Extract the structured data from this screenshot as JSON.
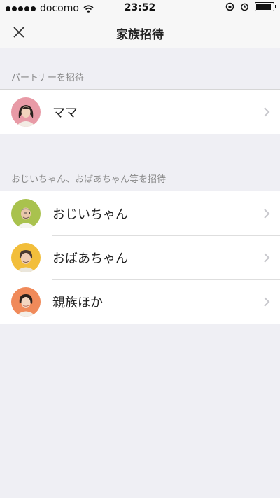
{
  "status": {
    "carrier": "docomo",
    "time": "23:52"
  },
  "nav": {
    "title": "家族招待"
  },
  "sections": [
    {
      "header": "パートナーを招待",
      "items": [
        {
          "label": "ママ",
          "avatar_bg": "#e89aa6"
        }
      ]
    },
    {
      "header": "おじいちゃん、おばあちゃん等を招待",
      "items": [
        {
          "label": "おじいちゃん",
          "avatar_bg": "#a9c24e"
        },
        {
          "label": "おばあちゃん",
          "avatar_bg": "#f2be3b"
        },
        {
          "label": "親族ほか",
          "avatar_bg": "#f08a5a"
        }
      ]
    }
  ],
  "icons": {
    "close": "close-icon",
    "chevron": "chevron-right-icon"
  }
}
